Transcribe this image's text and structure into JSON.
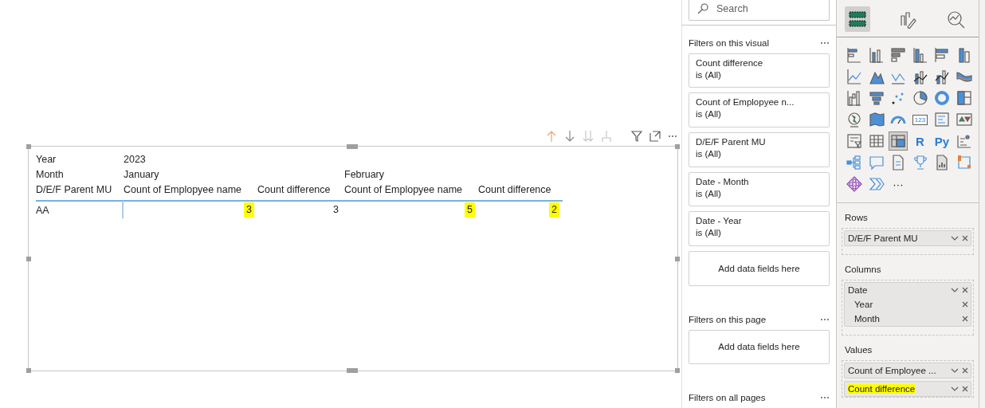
{
  "matrix": {
    "corner": [
      "Year",
      "Month",
      "D/E/F Parent MU"
    ],
    "year": "2023",
    "months": [
      {
        "name": "January",
        "measures": [
          "Count of Emplopyee name",
          "Count difference"
        ]
      },
      {
        "name": "February",
        "measures": [
          "Count of Emplopyee name",
          "Count difference"
        ]
      }
    ],
    "rows": [
      {
        "label": "AA",
        "values": [
          {
            "text": "3",
            "highlighted": true
          },
          {
            "text": "3",
            "highlighted": false
          },
          {
            "text": "5",
            "highlighted": true
          },
          {
            "text": "2",
            "highlighted": true
          }
        ]
      }
    ]
  },
  "filters": {
    "search": {
      "placeholder": "Search"
    },
    "sections": [
      {
        "title": "Filters on this visual",
        "cards": [
          {
            "field": "Count difference",
            "state": "is (All)"
          },
          {
            "field": "Count of Emplopyee n...",
            "state": "is (All)"
          },
          {
            "field": "D/E/F Parent MU",
            "state": "is (All)"
          },
          {
            "field": "Date - Month",
            "state": "is (All)"
          },
          {
            "field": "Date - Year",
            "state": "is (All)"
          }
        ],
        "add": "Add data fields here"
      },
      {
        "title": "Filters on this page",
        "add": "Add data fields here"
      },
      {
        "title": "Filters on all pages"
      }
    ]
  },
  "visualizations": {
    "tabs": [
      {
        "selected": true
      },
      {
        "selected": false
      },
      {
        "selected": false
      }
    ],
    "gallery": [
      {
        "kind": "icon",
        "selected": false
      },
      {
        "kind": "icon",
        "selected": false
      },
      {
        "kind": "icon",
        "selected": false
      },
      {
        "kind": "icon",
        "selected": false
      },
      {
        "kind": "icon",
        "selected": false
      },
      {
        "kind": "icon",
        "selected": false
      },
      {
        "kind": "icon",
        "selected": false
      },
      {
        "kind": "icon",
        "selected": false
      },
      {
        "kind": "icon",
        "selected": false
      },
      {
        "kind": "icon",
        "selected": false
      },
      {
        "kind": "icon",
        "selected": false
      },
      {
        "kind": "icon",
        "selected": false
      },
      {
        "kind": "icon",
        "selected": false
      },
      {
        "kind": "icon",
        "selected": false
      },
      {
        "kind": "icon",
        "selected": false
      },
      {
        "kind": "icon",
        "selected": false
      },
      {
        "kind": "icon",
        "selected": false
      },
      {
        "kind": "icon",
        "selected": false
      },
      {
        "kind": "icon",
        "selected": false
      },
      {
        "kind": "icon",
        "selected": false
      },
      {
        "kind": "icon",
        "selected": false
      },
      {
        "kind": "boxed",
        "label": "123",
        "selected": false
      },
      {
        "kind": "icon",
        "selected": false
      },
      {
        "kind": "icon",
        "selected": false
      },
      {
        "kind": "icon",
        "selected": false
      },
      {
        "kind": "icon",
        "selected": false
      },
      {
        "kind": "icon",
        "selected": true
      },
      {
        "kind": "letters",
        "label": "R",
        "selected": false
      },
      {
        "kind": "letters",
        "label": "Py",
        "selected": false
      },
      {
        "kind": "icon",
        "selected": false
      },
      {
        "kind": "icon",
        "selected": false
      },
      {
        "kind": "icon",
        "selected": false
      },
      {
        "kind": "icon",
        "selected": false
      },
      {
        "kind": "icon",
        "selected": false
      },
      {
        "kind": "icon",
        "selected": false
      },
      {
        "kind": "icon",
        "selected": false
      },
      {
        "kind": "icon",
        "selected": false
      },
      {
        "kind": "icon",
        "selected": false
      },
      {
        "kind": "more",
        "label": "···",
        "selected": false
      }
    ],
    "wells": [
      {
        "title": "Rows",
        "fields": [
          {
            "name": "D/E/F Parent MU",
            "highlighted": false
          }
        ]
      },
      {
        "title": "Columns",
        "fields": [
          {
            "name": "Date",
            "highlighted": false,
            "children": [
              {
                "name": "Year"
              },
              {
                "name": "Month"
              }
            ]
          }
        ]
      },
      {
        "title": "Values",
        "fields": [
          {
            "name": "Count of Employee ...",
            "highlighted": false
          },
          {
            "name": "Count difference",
            "highlighted": true
          }
        ]
      }
    ]
  }
}
